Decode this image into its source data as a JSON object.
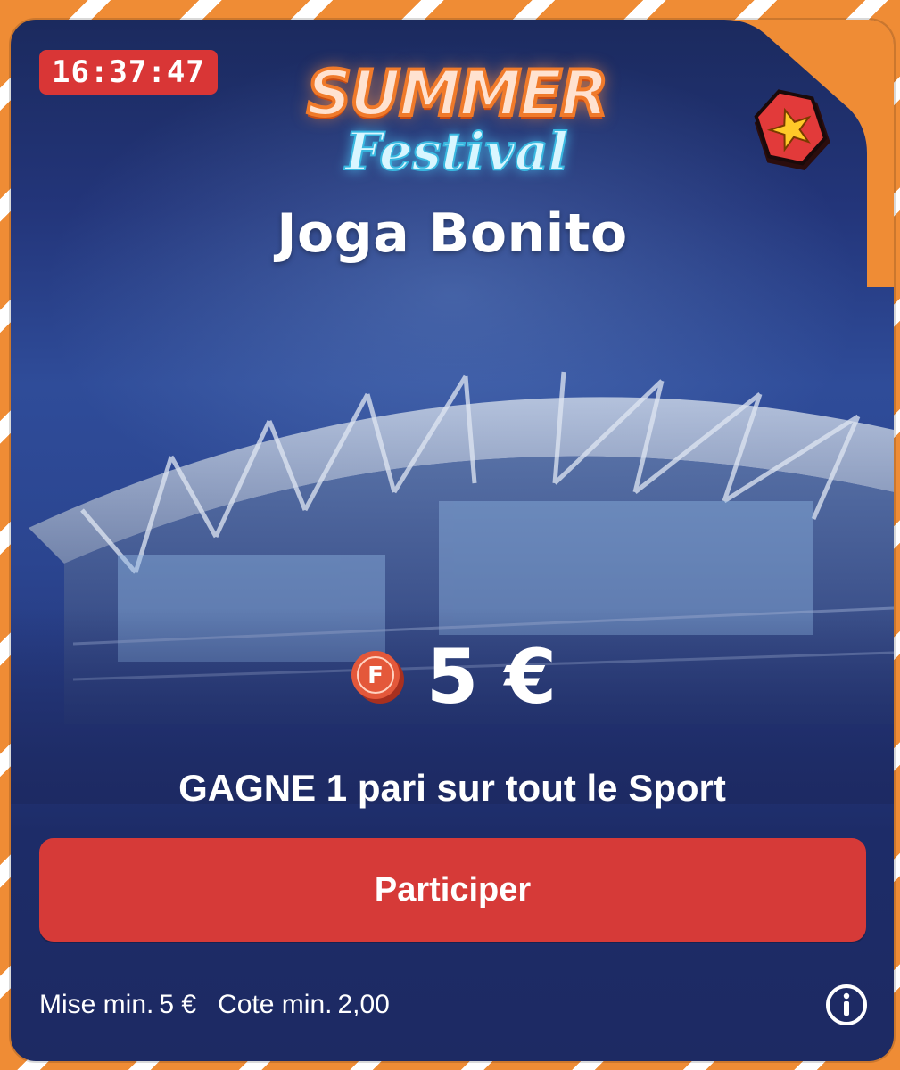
{
  "timer": "16:37:47",
  "logo": {
    "line1": "SUMMER",
    "line2": "Festival"
  },
  "title": "Joga Bonito",
  "badge": {
    "icon": "star-badge-icon"
  },
  "prize": {
    "coin_icon": "coin-f-icon",
    "coin_letter": "F",
    "amount": "5 €"
  },
  "subtitle": "GAGNE 1 pari sur tout le Sport",
  "cta": {
    "label": "Participer"
  },
  "footer": {
    "min_stake_label": "Mise min.",
    "min_stake_value": "5 €",
    "min_odds_label": "Cote min.",
    "min_odds_value": "2,00",
    "info_icon": "info-icon"
  },
  "colors": {
    "accent_orange": "#ef8c35",
    "card_navy": "#1d2a63",
    "cta_red": "#d63a38",
    "timer_red": "#d93636"
  }
}
